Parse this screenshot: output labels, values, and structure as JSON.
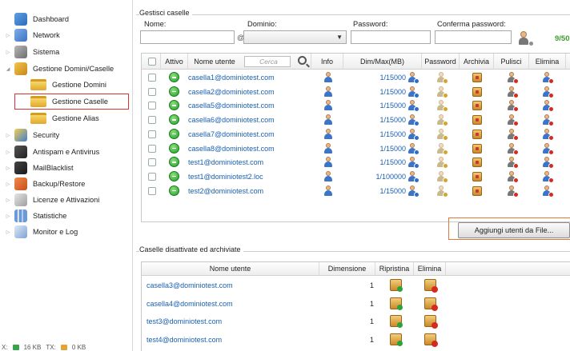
{
  "sidebar": {
    "items": [
      {
        "label": "Dashboard",
        "icon": "dashboard-icon"
      },
      {
        "label": "Network",
        "icon": "network-icon"
      },
      {
        "label": "Sistema",
        "icon": "tools-icon"
      },
      {
        "label": "Gestione Domini/Caselle",
        "icon": "mail-domains-icon"
      },
      {
        "label": "Gestione Domini",
        "icon": "folder-icon"
      },
      {
        "label": "Gestione Caselle",
        "icon": "folder-icon",
        "selected": true
      },
      {
        "label": "Gestione Alias",
        "icon": "folder-icon"
      },
      {
        "label": "Security",
        "icon": "security-icon"
      },
      {
        "label": "Antispam e Antivirus",
        "icon": "antispam-icon"
      },
      {
        "label": "MailBlacklist",
        "icon": "blacklist-icon"
      },
      {
        "label": "Backup/Restore",
        "icon": "backup-icon"
      },
      {
        "label": "Licenze e Attivazioni",
        "icon": "license-icon"
      },
      {
        "label": "Statistiche",
        "icon": "stats-icon"
      },
      {
        "label": "Monitor e Log",
        "icon": "monitor-icon"
      }
    ]
  },
  "status": {
    "rx_label": "X:",
    "rx_value": "16 KB",
    "tx_label": "TX:",
    "tx_value": "0 KB"
  },
  "form": {
    "group_title": "Gestisci caselle",
    "nome_label": "Nome:",
    "dominio_label": "Dominio:",
    "password_label": "Password:",
    "conferma_label": "Conferma password:",
    "nome_value": "",
    "password_value": "",
    "conferma_value": "",
    "dominio_value": "",
    "at_sign": "@",
    "count": "9/50"
  },
  "accounts_table": {
    "headers": {
      "attivo": "Attivo",
      "nome_utente": "Nome utente",
      "search_placeholder": "Cerca",
      "info": "Info",
      "dim": "Dim/Max(MB)",
      "password": "Password",
      "archivia": "Archivia",
      "pulisci": "Pulisci",
      "elimina": "Elimina"
    },
    "rows": [
      {
        "email": "casella1@dominiotest.com",
        "dim": "1/15000"
      },
      {
        "email": "casella2@dominiotest.com",
        "dim": "1/15000"
      },
      {
        "email": "casella5@dominiotest.com",
        "dim": "1/15000"
      },
      {
        "email": "casella6@dominiotest.com",
        "dim": "1/15000"
      },
      {
        "email": "casella7@dominiotest.com",
        "dim": "1/15000"
      },
      {
        "email": "casella8@dominiotest.com",
        "dim": "1/15000"
      },
      {
        "email": "test1@dominiotest.com",
        "dim": "1/15000"
      },
      {
        "email": "test1@dominiotest2.loc",
        "dim": "1/100000"
      },
      {
        "email": "test2@dominiotest.com",
        "dim": "1/15000"
      }
    ],
    "add_button": "Aggiungi utenti da File..."
  },
  "archived": {
    "group_title": "Caselle disattivate ed archiviate",
    "headers": {
      "nome_utente": "Nome utente",
      "dimensione": "Dimensione",
      "ripristina": "Ripristina",
      "elimina": "Elimina"
    },
    "rows": [
      {
        "email": "casella3@dominiotest.com",
        "size": "1"
      },
      {
        "email": "casella4@dominiotest.com",
        "size": "1"
      },
      {
        "email": "test3@dominiotest.com",
        "size": "1"
      },
      {
        "email": "test4@dominiotest.com",
        "size": "1"
      }
    ]
  }
}
